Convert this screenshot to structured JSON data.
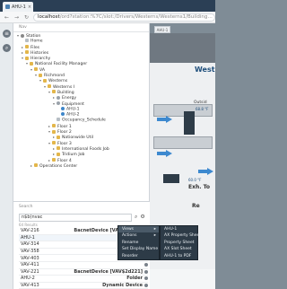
{
  "tab": {
    "title": "AHU-1",
    "close": "×"
  },
  "address": {
    "host": "localhost",
    "path": "/ord?station:%7C/slot:/Drivers/Westerns/Westerns1/Building…"
  },
  "nav": {
    "title": "Nav",
    "tree": [
      {
        "label": "Station",
        "depth": 0,
        "toggle": "▾",
        "icon": "station"
      },
      {
        "label": "Home",
        "depth": 1,
        "toggle": "",
        "icon": "file"
      },
      {
        "label": "Files",
        "depth": 1,
        "toggle": "▸",
        "icon": "folder"
      },
      {
        "label": "Histories",
        "depth": 1,
        "toggle": "▸",
        "icon": "folder"
      },
      {
        "label": "Hierarchy",
        "depth": 1,
        "toggle": "▾",
        "icon": "folder"
      },
      {
        "label": "National Facility Manager",
        "depth": 2,
        "toggle": "▾",
        "icon": "folder"
      },
      {
        "label": "VA",
        "depth": 3,
        "toggle": "▾",
        "icon": "folder"
      },
      {
        "label": "Richmond",
        "depth": 4,
        "toggle": "▾",
        "icon": "folder"
      },
      {
        "label": "Westerns",
        "depth": 5,
        "toggle": "▾",
        "icon": "folder"
      },
      {
        "label": "Westerns I",
        "depth": 6,
        "toggle": "▾",
        "icon": "folder"
      },
      {
        "label": "Building",
        "depth": 7,
        "toggle": "▾",
        "icon": "folder"
      },
      {
        "label": "Energy",
        "depth": 8,
        "toggle": "▸",
        "icon": "gear"
      },
      {
        "label": "Equipment",
        "depth": 8,
        "toggle": "▾",
        "icon": "gear"
      },
      {
        "label": "AHU-1",
        "depth": 9,
        "toggle": "",
        "icon": "point"
      },
      {
        "label": "AHU-2",
        "depth": 9,
        "toggle": "",
        "icon": "point"
      },
      {
        "label": "Occupancy_Schedule",
        "depth": 8,
        "toggle": "",
        "icon": "file"
      },
      {
        "label": "Floor 1",
        "depth": 7,
        "toggle": "▸",
        "icon": "folder"
      },
      {
        "label": "Floor 2",
        "depth": 7,
        "toggle": "▾",
        "icon": "folder"
      },
      {
        "label": "Nationwide Util",
        "depth": 8,
        "toggle": "▸",
        "icon": "folder"
      },
      {
        "label": "Floor 3",
        "depth": 7,
        "toggle": "▾",
        "icon": "folder"
      },
      {
        "label": "International Foods Job",
        "depth": 8,
        "toggle": "▸",
        "icon": "folder"
      },
      {
        "label": "Tridium Job",
        "depth": 8,
        "toggle": "▸",
        "icon": "folder"
      },
      {
        "label": "Floor 4",
        "depth": 7,
        "toggle": "▸",
        "icon": "folder"
      },
      {
        "label": "Operations Center",
        "depth": 3,
        "toggle": "▸",
        "icon": "folder"
      }
    ]
  },
  "view": {
    "tab_label": "AHU-1",
    "title": "West",
    "labels": [
      {
        "text": "Outsid",
        "cls": "l1"
      },
      {
        "text": "68.8 °F",
        "cls": "l2"
      },
      {
        "text": "60.0 °F",
        "cls": "l3"
      },
      {
        "text": "Exh. To",
        "cls": "l4"
      },
      {
        "text": "Re",
        "cls": "l5"
      }
    ]
  },
  "search": {
    "title": "Search",
    "query": "n$b(nvac",
    "sub": "64 Results",
    "results": [
      {
        "name": "VAV-216",
        "type": "BacnetDevice [VAV$2d216]"
      },
      {
        "name": "AHU-1",
        "type": ""
      },
      {
        "name": "VAV-314",
        "type": ""
      },
      {
        "name": "VAV-358",
        "type": ""
      },
      {
        "name": "VAV-403",
        "type": ""
      },
      {
        "name": "VAV-411",
        "type": ""
      },
      {
        "name": "VAV-221",
        "type": "BacnetDevice [VAV$2d221]"
      },
      {
        "name": "AHU-2",
        "type": "Folder"
      },
      {
        "name": "VAV-413",
        "type": "Dynamic Device"
      }
    ]
  },
  "context_menu": {
    "main": [
      "Views",
      "Actions",
      "Rename",
      "Set Display Name",
      "Reorder"
    ],
    "sub": [
      "AHU-1",
      "AX Property Sheet",
      "Property Sheet",
      "AX Slot Sheet",
      "AHU-1 to PDF"
    ]
  },
  "colors": {
    "tabbar": "#2b3f55",
    "accent": "#3d89cf",
    "title": "#1f4f7c"
  }
}
